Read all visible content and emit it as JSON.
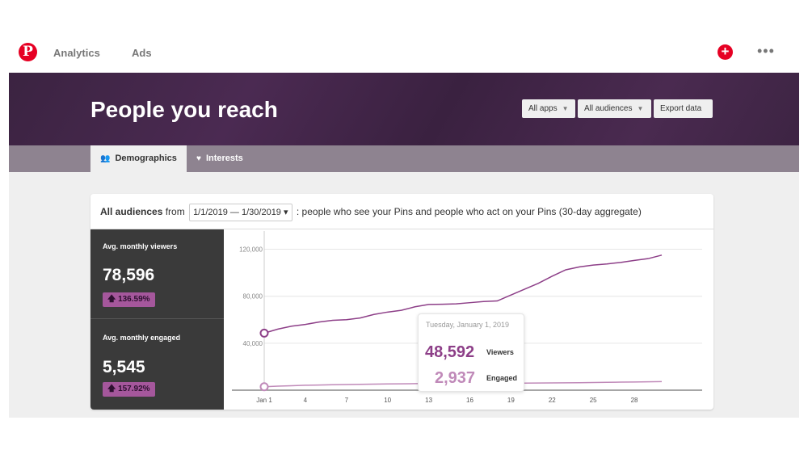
{
  "nav": {
    "logo": "P",
    "links": [
      "Analytics",
      "Ads"
    ],
    "add_icon": "plus-icon",
    "more_icon": "more-icon",
    "more_glyph": "•••"
  },
  "header": {
    "title": "People you reach",
    "filters": {
      "apps": "All apps",
      "audiences": "All audiences",
      "export": "Export data"
    }
  },
  "tabs": [
    {
      "label": "Demographics",
      "icon": "people-icon"
    },
    {
      "label": "Interests",
      "icon": "heart-icon"
    }
  ],
  "card": {
    "heading_bold": "All audiences",
    "heading_from": "from",
    "date_range": "1/1/2019 — 1/30/2019",
    "description": ": people who see your Pins and people who act on your Pins (30-day aggregate)"
  },
  "stats": [
    {
      "label": "Avg. monthly viewers",
      "value": "78,596",
      "change": "136.59%"
    },
    {
      "label": "Avg. monthly engaged",
      "value": "5,545",
      "change": "157.92%"
    }
  ],
  "tooltip": {
    "date": "Tuesday, January 1, 2019",
    "viewers_value": "48,592",
    "viewers_label": "Viewers",
    "engaged_value": "2,937",
    "engaged_label": "Engaged"
  },
  "colors": {
    "brand": "#e60023",
    "viewers": "#8d3f88",
    "engaged": "#c08ab9"
  },
  "chart_data": {
    "type": "line",
    "ylim": [
      0,
      130000
    ],
    "y_ticks": [
      "40,000",
      "80,000",
      "120,000"
    ],
    "y_tick_values": [
      40000,
      80000,
      120000
    ],
    "x_ticks": [
      "Jan 1",
      "4",
      "7",
      "10",
      "13",
      "16",
      "19",
      "22",
      "25",
      "28"
    ],
    "x_tick_days": [
      1,
      4,
      7,
      10,
      13,
      16,
      19,
      22,
      25,
      28
    ],
    "x": [
      1,
      2,
      3,
      4,
      5,
      6,
      7,
      8,
      9,
      10,
      11,
      12,
      13,
      14,
      15,
      16,
      17,
      18,
      19,
      20,
      21,
      22,
      23,
      24,
      25,
      26,
      27,
      28,
      29,
      30
    ],
    "series": [
      {
        "name": "Viewers",
        "values": [
          48592,
          52000,
          54500,
          56000,
          58000,
          59500,
          60000,
          61500,
          64500,
          66500,
          68000,
          71000,
          73000,
          73200,
          73500,
          74500,
          75500,
          76000,
          81000,
          86000,
          91000,
          97000,
          102500,
          105000,
          106500,
          107500,
          108800,
          110500,
          112000,
          115000
        ]
      },
      {
        "name": "Engaged",
        "values": [
          2937,
          3400,
          3800,
          4200,
          4400,
          4600,
          4800,
          5000,
          5150,
          5300,
          5450,
          5550,
          5650,
          5700,
          5750,
          5800,
          5850,
          5900,
          5950,
          6000,
          6100,
          6200,
          6300,
          6400,
          6550,
          6700,
          6850,
          7000,
          7150,
          7300
        ]
      }
    ],
    "grid": true
  }
}
